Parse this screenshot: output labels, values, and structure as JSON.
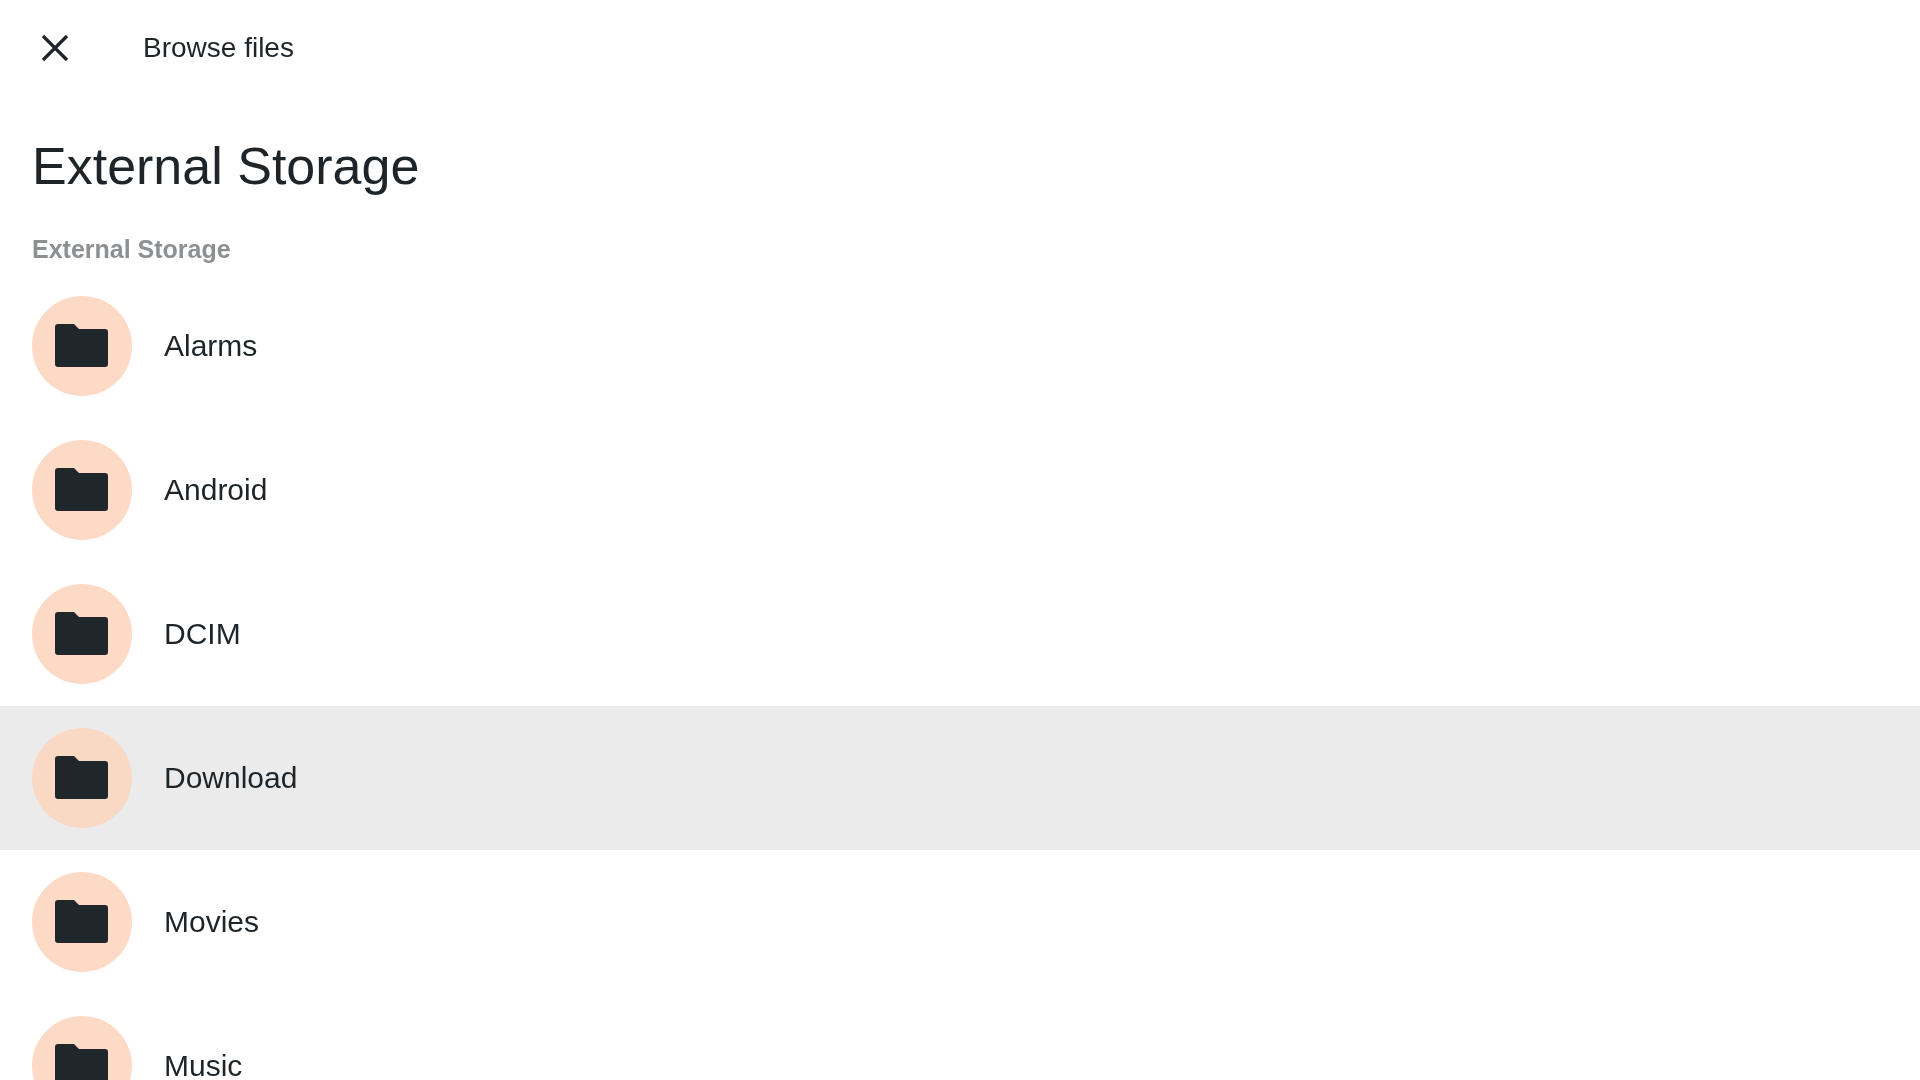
{
  "toolbar": {
    "title": "Browse files"
  },
  "heading": "External Storage",
  "section": {
    "label": "External Storage",
    "items": [
      {
        "name": "Alarms",
        "selected": false
      },
      {
        "name": "Android",
        "selected": false
      },
      {
        "name": "DCIM",
        "selected": false
      },
      {
        "name": "Download",
        "selected": true
      },
      {
        "name": "Movies",
        "selected": false
      },
      {
        "name": "Music",
        "selected": false
      }
    ]
  }
}
